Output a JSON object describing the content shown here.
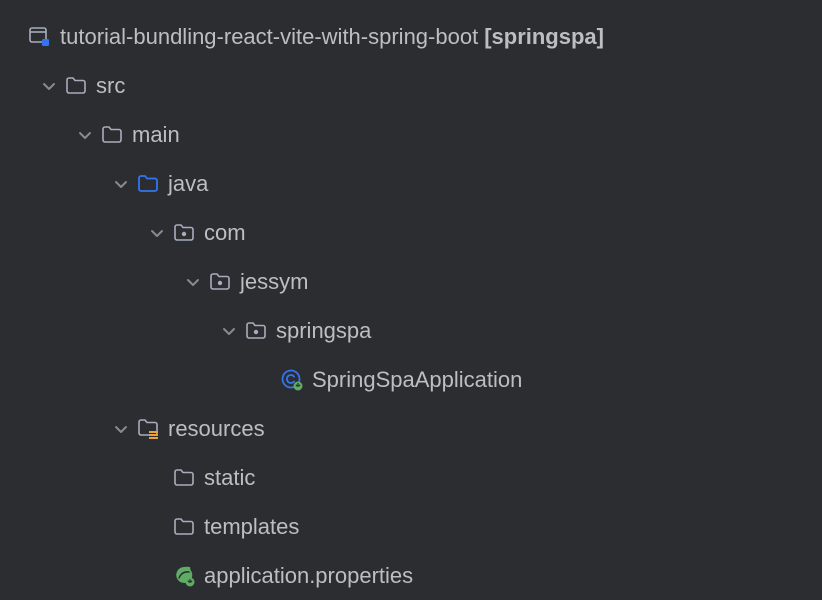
{
  "tree": {
    "root": {
      "label": "tutorial-bundling-react-vite-with-spring-boot",
      "vcs": "[springspa]"
    },
    "src": {
      "label": "src"
    },
    "main": {
      "label": "main"
    },
    "java": {
      "label": "java"
    },
    "com": {
      "label": "com"
    },
    "jessym": {
      "label": "jessym"
    },
    "springspa": {
      "label": "springspa"
    },
    "application": {
      "label": "SpringSpaApplication"
    },
    "resources": {
      "label": "resources"
    },
    "static": {
      "label": "static"
    },
    "templates": {
      "label": "templates"
    },
    "properties": {
      "label": "application.properties"
    }
  }
}
